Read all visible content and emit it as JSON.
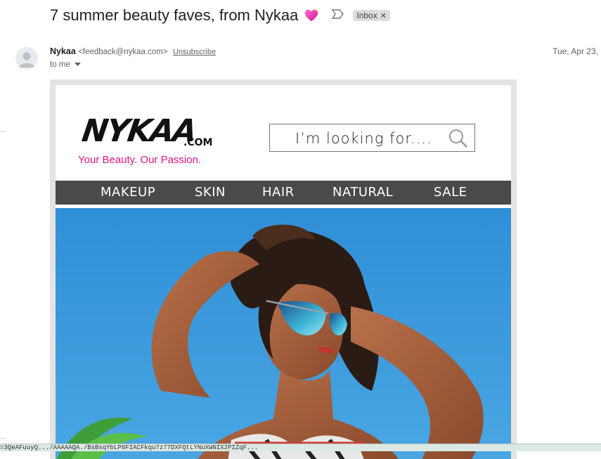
{
  "email": {
    "subject": "7 summer beauty faves, from Nykaa",
    "subject_emoji": "sparkling-heart",
    "label": "Inbox",
    "sender_name": "Nykaa",
    "sender_email": "<feedback@nykaa.com>",
    "unsubscribe": "Unsubscribe",
    "recipient": "to me",
    "date": "Tue, Apr 23,"
  },
  "newsletter": {
    "logo_text": "NYKAA",
    "logo_suffix": ".COM",
    "tagline": "Your Beauty. Our Passion.",
    "search_placeholder": "I’m looking for....",
    "nav": [
      "MAKEUP",
      "SKIN",
      "HAIR",
      "NATURAL",
      "SALE"
    ]
  },
  "status_url": "=3QeAFuuyQ.../AAAAAQA./BsBsqYbLP0FIACFkqu7z77DXFQtLYNuXWNIX2PIZqF..."
}
